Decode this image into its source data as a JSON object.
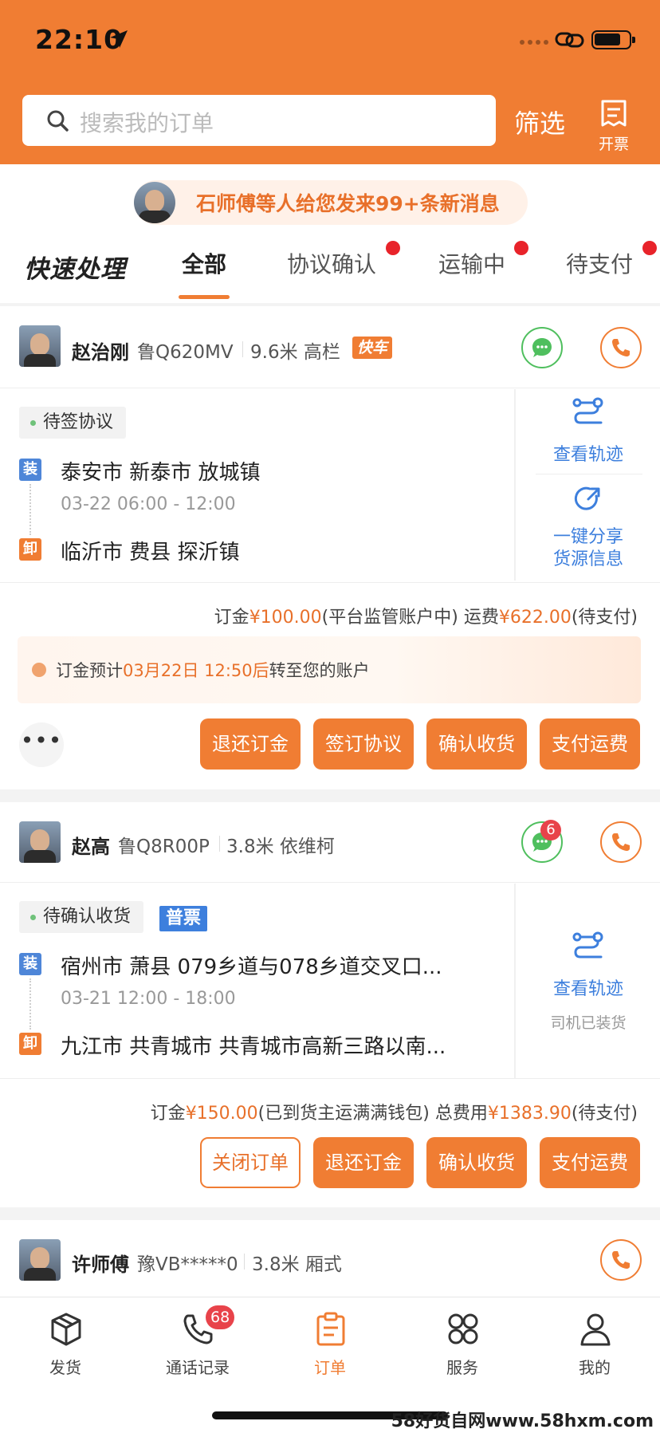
{
  "status_bar": {
    "time": "22:10"
  },
  "header": {
    "search_placeholder": "搜索我的订单",
    "filter_label": "筛选",
    "invoice_label": "开票"
  },
  "notice": {
    "text": "石师傅等人给您发来99+条新消息"
  },
  "tabs": {
    "quick_label": "快速处理",
    "items": [
      {
        "label": "全部"
      },
      {
        "label": "协议确认"
      },
      {
        "label": "运输中"
      },
      {
        "label": "待支付"
      }
    ]
  },
  "orders": [
    {
      "driver_name": "赵治刚",
      "plate": "鲁Q620MV",
      "vehicle": "9.6米 高栏",
      "fast_tag": "快车",
      "status": "待签协议",
      "load_tag": "装",
      "from": "泰安市 新泰市 放城镇",
      "time_range": "03-22 06:00 - 12:00",
      "unload_tag": "卸",
      "to": "临沂市 费县 探沂镇",
      "side_action_1": "查看轨迹",
      "side_action_2": "一键分享 货源信息",
      "fee_prefix": "订金",
      "deposit": "¥100.00",
      "deposit_note": "(平台监管账户中) 运费",
      "freight": "¥622.00",
      "freight_note": "(待支付)",
      "tip_prefix": "订金预计",
      "tip_time": "03月22日 12:50后",
      "tip_suffix": "转至您的账户",
      "more": "•••",
      "buttons": [
        "退还订金",
        "签订协议",
        "确认收货",
        "支付运费"
      ]
    },
    {
      "driver_name": "赵高",
      "plate": "鲁Q8R00P",
      "vehicle": "3.8米 依维柯",
      "chat_badge": "6",
      "status": "待确认收货",
      "invoice_tag": "普票",
      "load_tag": "装",
      "from": "宿州市 萧县 079乡道与078乡道交叉口...",
      "time_range": "03-21 12:00 - 18:00",
      "unload_tag": "卸",
      "to": "九江市 共青城市 共青城市高新三路以南...",
      "side_action_1": "查看轨迹",
      "side_note": "司机已装货",
      "fee_prefix": "订金",
      "deposit": "¥150.00",
      "deposit_note": "(已到货主运满满钱包) 总费用",
      "freight": "¥1383.90",
      "freight_note": "(待支付)",
      "buttons": [
        "关闭订单",
        "退还订金",
        "确认收货",
        "支付运费"
      ]
    },
    {
      "driver_name": "许师傅",
      "plate": "豫VB*****0",
      "vehicle": "3.8米 厢式"
    }
  ],
  "bottom_nav": [
    {
      "label": "发货",
      "icon": "box-icon"
    },
    {
      "label": "通话记录",
      "icon": "phone-icon",
      "badge": "68"
    },
    {
      "label": "订单",
      "icon": "clipboard-icon"
    },
    {
      "label": "服务",
      "icon": "grid-icon"
    },
    {
      "label": "我的",
      "icon": "user-icon"
    }
  ],
  "watermark": "58好货自网www.58hxm.com",
  "colors": {
    "brand": "#f07d33",
    "link_blue": "#3d7fdd",
    "wechat_green": "#4fbf5e",
    "alert_red": "#e8232a"
  }
}
